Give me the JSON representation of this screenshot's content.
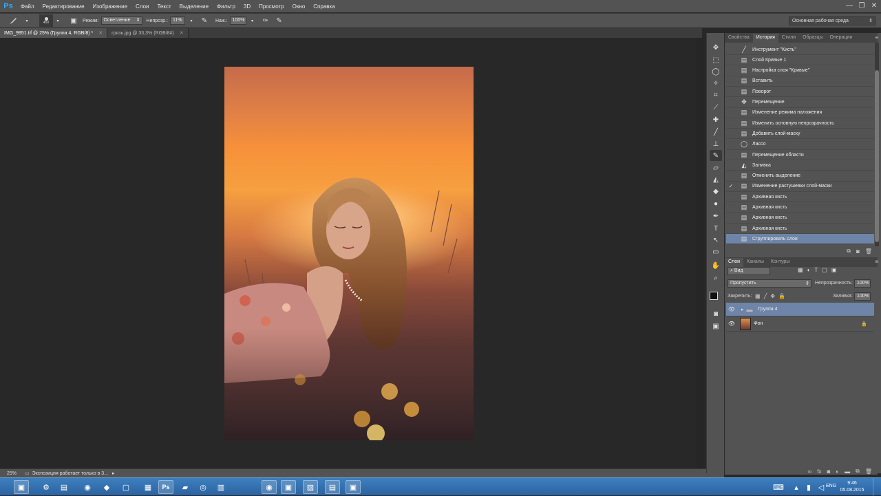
{
  "app": {
    "logo": "Ps",
    "menu": [
      "Файл",
      "Редактирование",
      "Изображение",
      "Слои",
      "Текст",
      "Выделение",
      "Фильтр",
      "3D",
      "Просмотр",
      "Окно",
      "Справка"
    ],
    "window_controls": [
      "—",
      "❐",
      "✕"
    ]
  },
  "options_bar": {
    "brush_size": "450",
    "mode_label": "Режим:",
    "mode_value": "Осветление",
    "opacity_label": "Непрозр.:",
    "opacity_value": "11%",
    "pressure_label": "Наж.:",
    "pressure_value": "100%",
    "workspace": "Основная рабочая среда"
  },
  "doc_tabs": [
    {
      "label": "IMG_9951.tif @ 25% (Группа 4, RGB/8) *",
      "active": true
    },
    {
      "label": "грязь.jpg @ 33,3% (RGB/8#)",
      "active": false
    }
  ],
  "status": {
    "zoom": "25%",
    "text": "Экспозиция работает только в 3..."
  },
  "history_panel": {
    "tabs": [
      "Свойства",
      "История",
      "Стили",
      "Образцы",
      "Операции"
    ],
    "active_tab": "История",
    "items": [
      {
        "icon": "brush-icon",
        "glyph": "╱",
        "label": "Инструмент \"Кисть\"",
        "checked": false
      },
      {
        "icon": "doc-icon",
        "glyph": "▤",
        "label": "Слой Кривые 1",
        "checked": false
      },
      {
        "icon": "doc-icon",
        "glyph": "▤",
        "label": "Настройка слоя \"Кривые\"",
        "checked": false
      },
      {
        "icon": "doc-icon",
        "glyph": "▤",
        "label": "Вставить",
        "checked": false
      },
      {
        "icon": "doc-icon",
        "glyph": "▤",
        "label": "Поворот",
        "checked": false
      },
      {
        "icon": "move-icon",
        "glyph": "✥",
        "label": "Перемещение",
        "checked": false
      },
      {
        "icon": "doc-icon",
        "glyph": "▤",
        "label": "Изменение режима наложения",
        "checked": false
      },
      {
        "icon": "doc-icon",
        "glyph": "▤",
        "label": "Изменить основную непрозрачность",
        "checked": false
      },
      {
        "icon": "doc-icon",
        "glyph": "▤",
        "label": "Добавить слой-маску",
        "checked": false
      },
      {
        "icon": "lasso-icon",
        "glyph": "◯",
        "label": "Лассо",
        "checked": false
      },
      {
        "icon": "doc-icon",
        "glyph": "▤",
        "label": "Перемещение области",
        "checked": false
      },
      {
        "icon": "bucket-icon",
        "glyph": "◭",
        "label": "Заливка",
        "checked": false
      },
      {
        "icon": "doc-icon",
        "glyph": "▤",
        "label": "Отменить выделение",
        "checked": false
      },
      {
        "icon": "doc-icon",
        "glyph": "▤",
        "label": "Изменение растушевки слой-маски",
        "checked": true
      },
      {
        "icon": "doc-icon",
        "glyph": "▤",
        "label": "Архивная кисть",
        "checked": false
      },
      {
        "icon": "doc-icon",
        "glyph": "▤",
        "label": "Архивная кисть",
        "checked": false
      },
      {
        "icon": "doc-icon",
        "glyph": "▤",
        "label": "Архивная кисть",
        "checked": false
      },
      {
        "icon": "doc-icon",
        "glyph": "▤",
        "label": "Архивная кисть",
        "checked": false
      },
      {
        "icon": "doc-icon",
        "glyph": "▤",
        "label": "Сгруппировать слои",
        "checked": false,
        "selected": true
      }
    ]
  },
  "layers_panel": {
    "tabs": [
      "Слои",
      "Каналы",
      "Контуры"
    ],
    "active_tab": "Слои",
    "filter_label": "Вид",
    "blend_mode": "Пропустить",
    "opacity_label": "Непрозрачность:",
    "opacity_value": "100%",
    "lock_label": "Закрепить:",
    "fill_label": "Заливка:",
    "fill_value": "100%",
    "layers": [
      {
        "name": "Группа 4",
        "type": "group",
        "selected": true
      },
      {
        "name": "Фон",
        "type": "background",
        "selected": false,
        "locked": true
      }
    ]
  },
  "taskbar": {
    "lang": "ENG",
    "time": "9:46",
    "date": "05.08.2015"
  },
  "colors": {
    "ui_dark": "#535353",
    "selection": "#6e84a8",
    "taskbar": "#2c63a0"
  }
}
